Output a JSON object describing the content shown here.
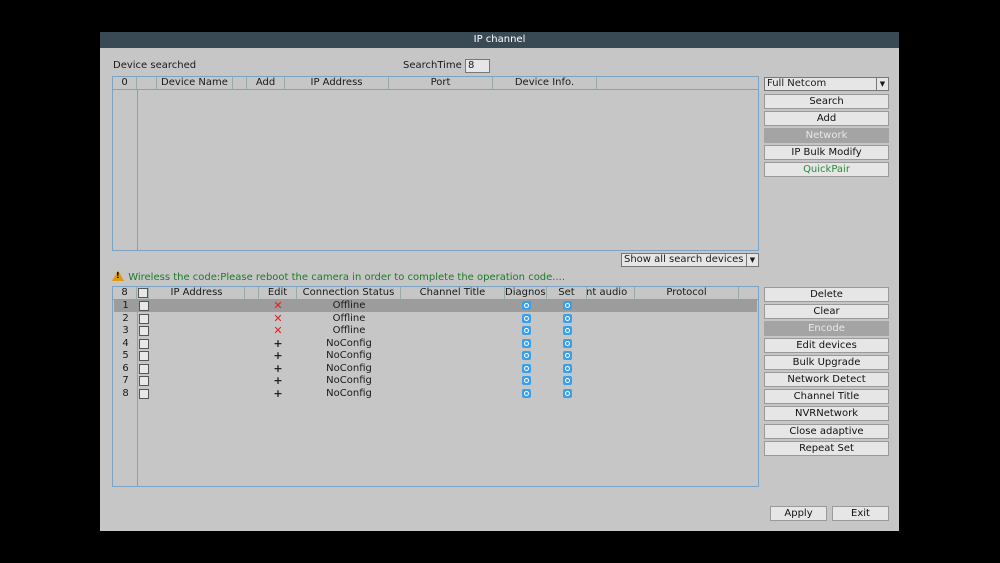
{
  "window": {
    "title": "IP channel"
  },
  "search": {
    "label": "Device searched",
    "time_label": "SearchTime",
    "time_value": "8",
    "protocol_select": "Full Netcom",
    "filter_select": "Show all search devices",
    "columns": [
      "0",
      "",
      "Device Name",
      "",
      "Add",
      "IP Address",
      "Port",
      "Device Info."
    ]
  },
  "search_buttons": {
    "search": "Search",
    "add": "Add",
    "network": "Network",
    "ip_bulk_modify": "IP Bulk Modify",
    "quickpair": "QuickPair"
  },
  "warning": "Wireless the code:Please reboot the camera in order to complete the operation code....",
  "channels": {
    "columns": [
      "8",
      "",
      "IP Address",
      "",
      "Edit",
      "Connection Status",
      "Channel Title",
      "Diagnosis",
      "Set",
      "Front audio",
      "Protocol"
    ],
    "rows": [
      {
        "num": "1",
        "edit": "delete",
        "edit_glyph": "✕",
        "status": "Offline",
        "selected": true
      },
      {
        "num": "2",
        "edit": "delete",
        "edit_glyph": "✕",
        "status": "Offline",
        "selected": false
      },
      {
        "num": "3",
        "edit": "delete",
        "edit_glyph": "✕",
        "status": "Offline",
        "selected": false
      },
      {
        "num": "4",
        "edit": "add",
        "edit_glyph": "+",
        "status": "NoConfig",
        "selected": false
      },
      {
        "num": "5",
        "edit": "add",
        "edit_glyph": "+",
        "status": "NoConfig",
        "selected": false
      },
      {
        "num": "6",
        "edit": "add",
        "edit_glyph": "+",
        "status": "NoConfig",
        "selected": false
      },
      {
        "num": "7",
        "edit": "add",
        "edit_glyph": "+",
        "status": "NoConfig",
        "selected": false
      },
      {
        "num": "8",
        "edit": "add",
        "edit_glyph": "+",
        "status": "NoConfig",
        "selected": false
      }
    ]
  },
  "channel_buttons": {
    "delete": "Delete",
    "clear": "Clear",
    "encode": "Encode",
    "edit_devices": "Edit devices",
    "bulk_upgrade": "Bulk Upgrade",
    "network_detect": "Network Detect",
    "channel_title": "Channel Title",
    "nvr_network": "NVRNetwork",
    "close_adaptive": "Close adaptive",
    "repeat_set": "Repeat Set"
  },
  "footer": {
    "apply": "Apply",
    "exit": "Exit"
  },
  "colors": {
    "titlebar": "#3a4a54",
    "panel": "#c6c6c6",
    "delete_mark": "#e0201c",
    "icon": "#3aa0ea",
    "warning_text": "#1e7a2a"
  }
}
